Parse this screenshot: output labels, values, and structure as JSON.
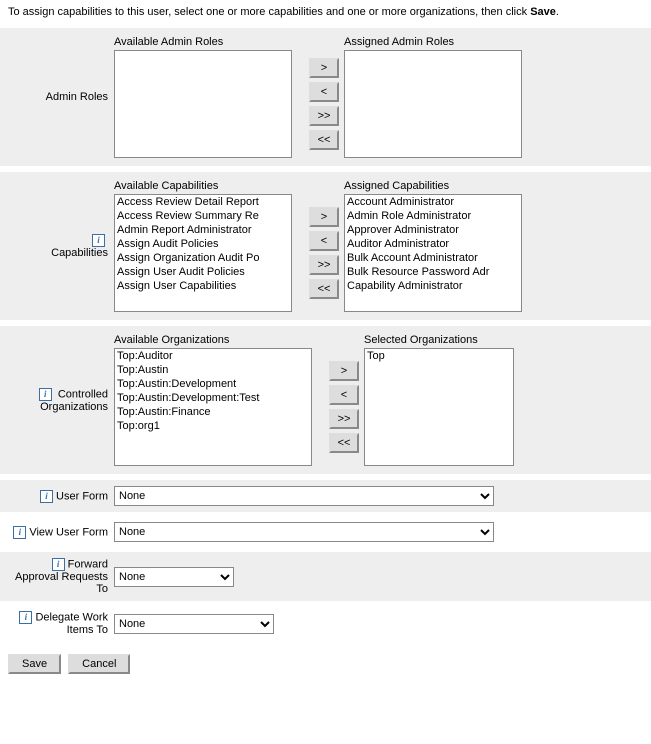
{
  "intro": {
    "prefix": "To assign capabilities to this user, select one or more capabilities and one or more organizations, then click",
    "bold": "Save",
    "suffix": "."
  },
  "adminRoles": {
    "label": "Admin Roles",
    "availableLabel": "Available Admin Roles",
    "assignedLabel": "Assigned Admin Roles",
    "available": [],
    "assigned": []
  },
  "capabilities": {
    "label": "Capabilities",
    "availableLabel": "Available Capabilities",
    "assignedLabel": "Assigned Capabilities",
    "available": [
      "Access Review Detail Report",
      "Access Review Summary Re",
      "Admin Report Administrator",
      "Assign Audit Policies",
      "Assign Organization Audit Po",
      "Assign User Audit Policies",
      "Assign User Capabilities"
    ],
    "assigned": [
      "Account Administrator",
      "Admin Role Administrator",
      "Approver Administrator",
      "Auditor Administrator",
      "Bulk Account Administrator",
      "Bulk Resource Password Adr",
      "Capability Administrator"
    ]
  },
  "organizations": {
    "label": "Controlled Organizations",
    "availableLabel": "Available Organizations",
    "selectedLabel": "Selected Organizations",
    "available": [
      "Top:Auditor",
      "Top:Austin",
      "Top:Austin:Development",
      "Top:Austin:Development:Test",
      "Top:Austin:Finance",
      "Top:org1"
    ],
    "selected": [
      "Top"
    ]
  },
  "shuttle": {
    "add": ">",
    "remove": "<",
    "addAll": ">>",
    "removeAll": "<<"
  },
  "userForm": {
    "label": "User Form",
    "value": "None"
  },
  "viewUserForm": {
    "label": "View User Form",
    "value": "None"
  },
  "forwardApproval": {
    "label": "Forward Approval Requests To",
    "value": "None"
  },
  "delegateWorkItems": {
    "label": "Delegate Work Items To",
    "value": "None"
  },
  "buttons": {
    "save": "Save",
    "cancel": "Cancel"
  }
}
